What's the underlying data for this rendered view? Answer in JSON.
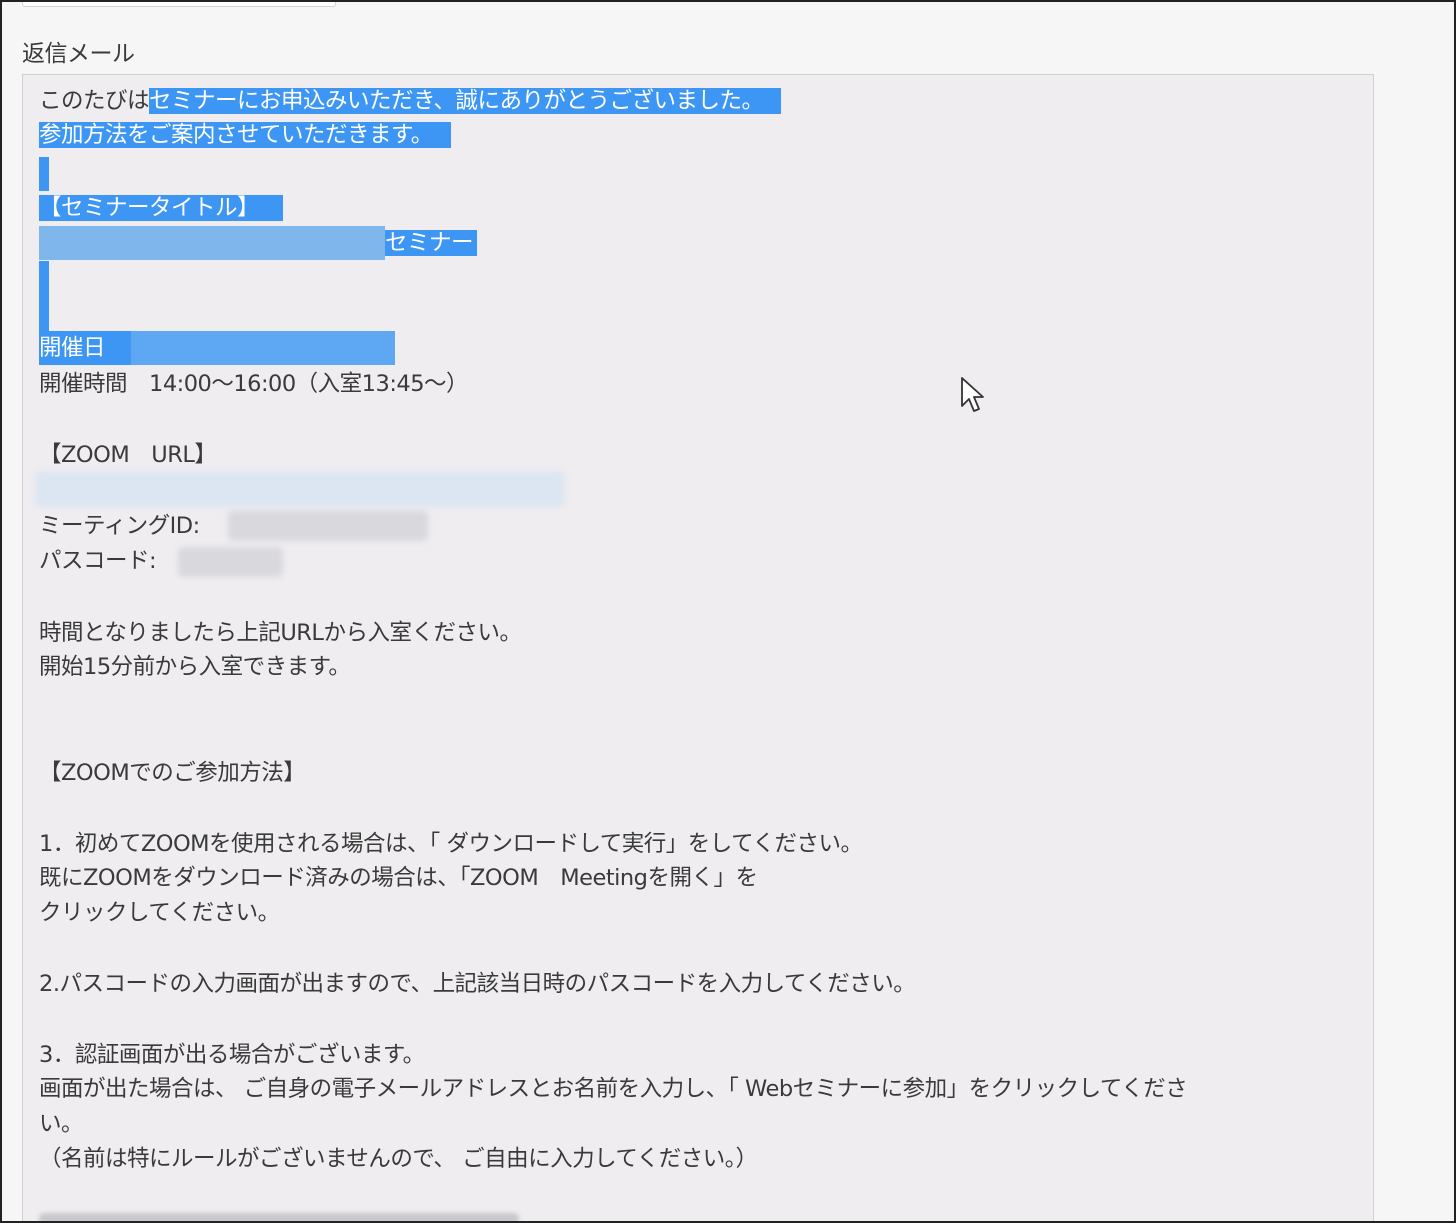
{
  "form": {
    "field_label": "返信メール"
  },
  "reply_mail": {
    "intro_plain": "このたびは",
    "intro_selected": "セミナーにお申込みいただき、誠にありがとうございました。",
    "guide": "参加方法をご案内させていただきます。",
    "title_heading": "【セミナータイトル】",
    "title_suffix": "セミナー",
    "date_label": "開催日",
    "time_line": "開催時間　14:00～16:00（入室13:45～）",
    "zoom_url_heading": "【ZOOM　URL】",
    "meeting_id_label": "ミーティングID:",
    "passcode_label": "パスコード:",
    "join_note_1": "時間となりましたら上記URLから入室ください。",
    "join_note_2": "開始15分前から入室できます。",
    "howto_heading": "【ZOOMでのご参加方法】",
    "step1_a": "1．初めてZOOMを使用される場合は、「 ダウンロードして実行」をしてください。",
    "step1_b": "既にZOOMをダウンロード済みの場合は、「ZOOM　Meetingを開く」を",
    "step1_c": "クリックしてください。",
    "step2": "2.パスコードの入力画面が出ますので、上記該当日時のパスコードを入力してください。",
    "step3_a": "3．認証画面が出る場合がございます。",
    "step3_b": "画面が出た場合は、 ご自身の電子メールアドレスとお名前を入力し、「 Webセミナーに参加」をクリックしてくださ",
    "step3_c": "い。",
    "step3_d": "（名前は特にルールがございませんので、 ご自由に入力してください。）"
  },
  "colors": {
    "selection": "#3d96f4",
    "textarea_bg": "#efedf0",
    "text": "#3a3a3a"
  },
  "icons": {
    "cursor": "mouse-pointer-icon"
  }
}
